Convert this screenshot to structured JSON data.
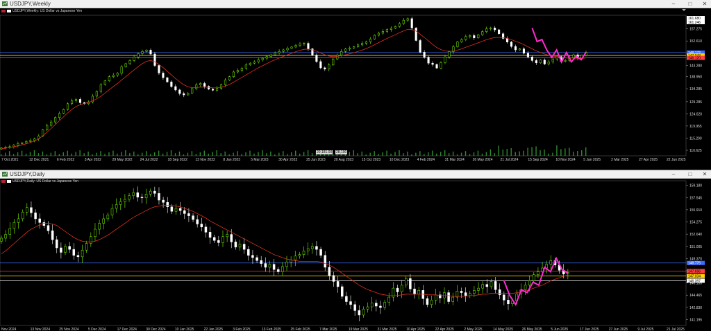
{
  "windows": [
    {
      "id": "weekly",
      "title": "USDJPY,Weekly",
      "symbol_label": "USDJPY,Weekly: US Dollar vs Japanese Yen",
      "buttons": [
        "–",
        "□",
        "✕"
      ],
      "y_ticks": [
        "157.275",
        "152.610",
        "147.945",
        "143.280",
        "138.950",
        "134.285",
        "129.285",
        "124.620",
        "119.955",
        "115.290",
        "110.625"
      ],
      "top_tags": [
        "161.680",
        "161.246"
      ],
      "price_tags": [
        {
          "label": "148.172",
          "color": "#3a6cff"
        },
        {
          "label": "147.049",
          "color": "#ffd200"
        },
        {
          "label": "146.120",
          "color": "#ff4040"
        }
      ],
      "volume_tags": [
        "20,181.00",
        "28,100"
      ],
      "x_labels": [
        "7 Oct 2021",
        "12 Dec 2021",
        "6 Feb 2022",
        "3 Apr 2022",
        "29 May 2022",
        "24 Jul 2022",
        "18 Sep 2022",
        "13 Nov 2022",
        "8 Jan 2023",
        "5 Mar 2023",
        "30 Apr 2023",
        "25 Jun 2023",
        "20 Aug 2023",
        "15 Oct 2023",
        "10 Dec 2023",
        "4 Feb 2024",
        "31 Mar 2024",
        "26 May 2024",
        "21 Jul 2024",
        "15 Sep 2024",
        "10 Nov 2024",
        "5 Jan 2025",
        "2 Mar 2025",
        "27 Apr 2025",
        "22 Jun 2025"
      ]
    },
    {
      "id": "daily",
      "title": "USDJPY,Daily",
      "symbol_label": "USDJPY,Daily: US Dollar vs Japanese Yen",
      "buttons": [
        "–",
        "□",
        "✕"
      ],
      "y_ticks": [
        "159.180",
        "157.545",
        "155.910",
        "154.275",
        "152.640",
        "151.005",
        "149.370",
        "147.735",
        "146.100",
        "144.465",
        "142.830",
        "141.195"
      ],
      "price_tags": [
        {
          "label": "148.775",
          "color": "#3a6cff"
        },
        {
          "label": "147.696",
          "color": "#ff4040"
        },
        {
          "label": "147.034",
          "color": "#ffd200"
        },
        {
          "label": "146.397",
          "color": "#ffffff"
        }
      ],
      "x_labels": [
        "Nov 2024",
        "13 Nov 2024",
        "25 Nov 2024",
        "5 Dec 2024",
        "17 Dec 2024",
        "30 Dec 2024",
        "10 Jan 2025",
        "22 Jan 2025",
        "3 Feb 2025",
        "13 Feb 2025",
        "25 Feb 2025",
        "7 Mar 2025",
        "19 Mar 2025",
        "31 Mar 2025",
        "10 Apr 2025",
        "22 Apr 2025",
        "2 May 2025",
        "14 May 2025",
        "26 May 2025",
        "5 Jun 2025",
        "17 Jun 2025",
        "27 Jun 2025",
        "9 Jul 2025",
        "21 Jul 2025"
      ]
    }
  ],
  "chart_data": [
    {
      "type": "line",
      "subtype": "candlestick",
      "title": "USDJPY,Weekly: US Dollar vs Japanese Yen",
      "ylim": [
        108.5,
        162.5
      ],
      "series": [
        {
          "name": "close",
          "values": [
            111.5,
            111.8,
            112.0,
            112.6,
            113.2,
            113.5,
            114.0,
            114.4,
            115.0,
            116.1,
            118.5,
            120.2,
            121.5,
            123.2,
            124.8,
            126.3,
            128.5,
            129.6,
            130.2,
            128.9,
            128.5,
            129.2,
            131.4,
            133.2,
            135.8,
            137.3,
            138.9,
            139.5,
            140.2,
            142.7,
            143.9,
            145.1,
            146.4,
            147.8,
            148.6,
            149.1,
            147.6,
            143.2,
            140.3,
            138.5,
            136.9,
            135.1,
            133.8,
            132.4,
            131.9,
            132.6,
            134.3,
            135.7,
            136.3,
            135.2,
            134.1,
            133.7,
            134.5,
            135.8,
            137.6,
            138.9,
            140.7,
            141.3,
            142.2,
            143.4,
            144.1,
            144.6,
            145.4,
            146.0,
            146.6,
            147.3,
            148.0,
            148.6,
            149.2,
            149.8,
            150.3,
            150.9,
            151.4,
            151.7,
            149.6,
            147.2,
            144.7,
            142.3,
            141.8,
            143.4,
            145.7,
            147.2,
            148.6,
            149.5,
            149.9,
            150.4,
            151.1,
            151.7,
            152.3,
            153.4,
            154.8,
            155.6,
            156.3,
            157.0,
            157.5,
            158.2,
            159.3,
            160.6,
            161.2,
            157.6,
            152.8,
            148.3,
            146.4,
            144.1,
            143.6,
            142.2,
            144.3,
            146.5,
            148.5,
            150.4,
            152.3,
            153.1,
            154.3,
            154.7,
            153.8,
            155.0,
            156.2,
            157.3,
            157.6,
            156.9,
            155.4,
            153.6,
            152.2,
            150.5,
            149.2,
            149.6,
            147.9,
            146.5,
            145.1,
            144.2,
            145.3,
            143.8,
            144.6,
            145.7,
            146.6,
            144.8,
            145.1,
            146.2,
            147.3,
            146.0,
            147.1,
            148.3
          ]
        },
        {
          "name": "moving-average",
          "values": [
            111.2,
            111.4,
            111.7,
            112.0,
            112.3,
            112.7,
            113.1,
            113.6,
            114.2,
            115.0,
            116.2,
            117.6,
            119.0,
            120.5,
            122.0,
            123.5,
            125.0,
            126.3,
            127.4,
            128.1,
            128.6,
            129.0,
            129.6,
            130.4,
            131.4,
            132.6,
            133.9,
            135.1,
            136.3,
            137.6,
            138.9,
            140.2,
            141.5,
            142.8,
            143.9,
            144.8,
            145.1,
            144.6,
            143.6,
            142.4,
            141.0,
            139.6,
            138.2,
            136.9,
            135.8,
            135.0,
            134.7,
            134.7,
            134.9,
            134.9,
            134.8,
            134.6,
            134.6,
            134.8,
            135.3,
            135.9,
            136.8,
            137.7,
            138.6,
            139.6,
            140.5,
            141.4,
            142.3,
            143.1,
            143.9,
            144.7,
            145.4,
            146.1,
            146.7,
            147.3,
            147.9,
            148.5,
            149.0,
            149.4,
            149.5,
            149.2,
            148.7,
            148.0,
            147.3,
            146.8,
            146.6,
            146.7,
            147.0,
            147.3,
            147.7,
            148.1,
            148.6,
            149.1,
            149.7,
            150.4,
            151.2,
            152.0,
            152.8,
            153.6,
            154.3,
            155.0,
            155.8,
            156.5,
            157.1,
            157.0,
            156.4,
            155.2,
            154.0,
            152.6,
            151.3,
            150.1,
            149.3,
            148.8,
            148.6,
            148.7,
            149.1,
            149.6,
            150.2,
            150.8,
            151.3,
            151.9,
            152.5,
            153.1,
            153.6,
            153.9,
            154.0,
            153.9,
            153.6,
            153.1,
            152.5,
            151.9,
            151.2,
            150.4,
            149.6,
            148.8,
            148.2,
            147.6,
            147.1,
            146.8,
            146.6,
            146.3,
            146.1,
            146.0,
            146.0,
            145.9,
            145.9,
            146.1
          ]
        },
        {
          "name": "zigzag",
          "values": [
            157.6,
            152.4,
            153.2,
            149.1,
            146.3,
            149.2,
            144.5,
            148.2,
            144.6,
            146.8,
            145.4,
            148.3
          ]
        }
      ],
      "x_tick_labels": [
        "7 Oct 2021",
        "12 Dec 2021",
        "6 Feb 2022",
        "3 Apr 2022",
        "29 May 2022",
        "24 Jul 2022",
        "18 Sep 2022",
        "13 Nov 2022",
        "8 Jan 2023",
        "5 Mar 2023",
        "30 Apr 2023",
        "25 Jun 2023",
        "20 Aug 2023",
        "15 Oct 2023",
        "10 Dec 2023",
        "4 Feb 2024",
        "31 Mar 2024",
        "26 May 2024",
        "21 Jul 2024",
        "15 Sep 2024",
        "10 Nov 2024",
        "5 Jan 2025",
        "2 Mar 2025",
        "27 Apr 2025",
        "22 Jun 2025"
      ],
      "horizontal_levels": [
        {
          "value": 148.17,
          "color": "#3a6cff"
        },
        {
          "value": 147.05,
          "color": "#ffd200"
        },
        {
          "value": 146.12,
          "color": "#ff4040"
        }
      ],
      "grid": false
    },
    {
      "type": "line",
      "subtype": "candlestick",
      "title": "USDJPY,Daily: US Dollar vs Japanese Yen",
      "ylim": [
        140.4,
        159.8
      ],
      "series": [
        {
          "name": "close",
          "values": [
            152.1,
            152.6,
            153.4,
            154.2,
            154.7,
            155.6,
            156.2,
            155.5,
            154.7,
            154.2,
            153.8,
            153.1,
            151.9,
            150.8,
            150.2,
            151.0,
            150.6,
            149.8,
            149.6,
            150.5,
            151.4,
            152.3,
            153.3,
            154.1,
            154.7,
            155.2,
            156.1,
            156.6,
            157.0,
            157.3,
            157.8,
            158.2,
            157.6,
            157.5,
            158.0,
            158.4,
            158.1,
            157.2,
            156.9,
            156.3,
            155.7,
            156.1,
            155.8,
            155.4,
            155.1,
            154.6,
            154.0,
            153.6,
            152.9,
            152.2,
            151.8,
            151.5,
            152.3,
            152.6,
            151.6,
            150.9,
            151.3,
            150.6,
            149.8,
            149.5,
            149.1,
            148.7,
            148.2,
            148.6,
            147.9,
            147.6,
            148.3,
            148.9,
            149.2,
            149.7,
            149.9,
            150.4,
            150.7,
            151.0,
            150.6,
            149.8,
            148.2,
            147.1,
            146.3,
            145.6,
            144.3,
            143.6,
            143.2,
            142.4,
            141.8,
            142.6,
            142.9,
            143.4,
            143.0,
            142.8,
            143.5,
            144.2,
            145.4,
            144.9,
            145.8,
            146.7,
            145.3,
            144.6,
            145.1,
            144.0,
            143.2,
            143.8,
            144.5,
            144.1,
            144.8,
            143.6,
            144.2,
            145.0,
            144.8,
            144.4,
            144.7,
            145.1,
            145.4,
            145.9,
            145.6,
            146.3,
            145.2,
            144.5,
            143.8,
            143.3,
            143.7,
            144.6,
            145.2,
            145.8,
            146.4,
            147.2,
            147.6,
            148.1,
            148.6,
            149.1,
            148.5,
            147.8,
            147.3,
            147.5
          ]
        },
        {
          "name": "moving-average",
          "values": [
            150.0,
            150.4,
            150.9,
            151.4,
            151.9,
            152.4,
            152.9,
            153.3,
            153.6,
            153.9,
            154.1,
            154.1,
            154.0,
            153.8,
            153.4,
            153.0,
            152.6,
            152.2,
            151.9,
            151.7,
            151.6,
            151.6,
            151.7,
            151.9,
            152.2,
            152.5,
            152.9,
            153.3,
            153.7,
            154.1,
            154.5,
            154.9,
            155.2,
            155.5,
            155.8,
            156.1,
            156.3,
            156.4,
            156.5,
            156.5,
            156.5,
            156.4,
            156.3,
            156.1,
            155.9,
            155.7,
            155.4,
            155.1,
            154.8,
            154.4,
            154.1,
            153.8,
            153.5,
            153.2,
            152.9,
            152.6,
            152.3,
            152.0,
            151.7,
            151.4,
            151.1,
            150.8,
            150.5,
            150.2,
            149.9,
            149.7,
            149.5,
            149.3,
            149.2,
            149.1,
            149.0,
            149.0,
            149.0,
            149.0,
            149.0,
            148.9,
            148.7,
            148.5,
            148.2,
            147.8,
            147.4,
            147.0,
            146.6,
            146.2,
            145.8,
            145.5,
            145.2,
            145.0,
            144.8,
            144.6,
            144.5,
            144.4,
            144.4,
            144.4,
            144.5,
            144.6,
            144.6,
            144.6,
            144.6,
            144.6,
            144.5,
            144.5,
            144.5,
            144.4,
            144.4,
            144.4,
            144.3,
            144.3,
            144.3,
            144.3,
            144.4,
            144.4,
            144.5,
            144.6,
            144.6,
            144.7,
            144.7,
            144.7,
            144.7,
            144.7,
            144.7,
            144.8,
            144.9,
            145.0,
            145.2,
            145.4,
            145.6,
            145.8,
            146.1,
            146.4,
            146.6,
            146.8,
            147.0,
            147.1
          ]
        },
        {
          "name": "zigzag",
          "values": [
            146.4,
            144.4,
            143.2,
            145.2,
            144.8,
            146.2,
            145.8,
            148.2,
            147.6,
            149.4,
            147.9,
            147.4
          ]
        }
      ],
      "x_tick_labels": [
        "Nov 2024",
        "13 Nov 2024",
        "25 Nov 2024",
        "5 Dec 2024",
        "17 Dec 2024",
        "30 Dec 2024",
        "10 Jan 2025",
        "22 Jan 2025",
        "3 Feb 2025",
        "13 Feb 2025",
        "25 Feb 2025",
        "7 Mar 2025",
        "19 Mar 2025",
        "31 Mar 2025",
        "10 Apr 2025",
        "22 Apr 2025",
        "2 May 2025",
        "14 May 2025",
        "26 May 2025",
        "5 Jun 2025",
        "17 Jun 2025",
        "27 Jun 2025",
        "9 Jul 2025",
        "21 Jul 2025"
      ],
      "horizontal_levels": [
        {
          "value": 148.78,
          "color": "#3a6cff"
        },
        {
          "value": 147.7,
          "color": "#ff4040"
        },
        {
          "value": 147.03,
          "color": "#ffd200"
        },
        {
          "value": 146.4,
          "color": "#ffffff"
        }
      ],
      "grid": false
    }
  ]
}
